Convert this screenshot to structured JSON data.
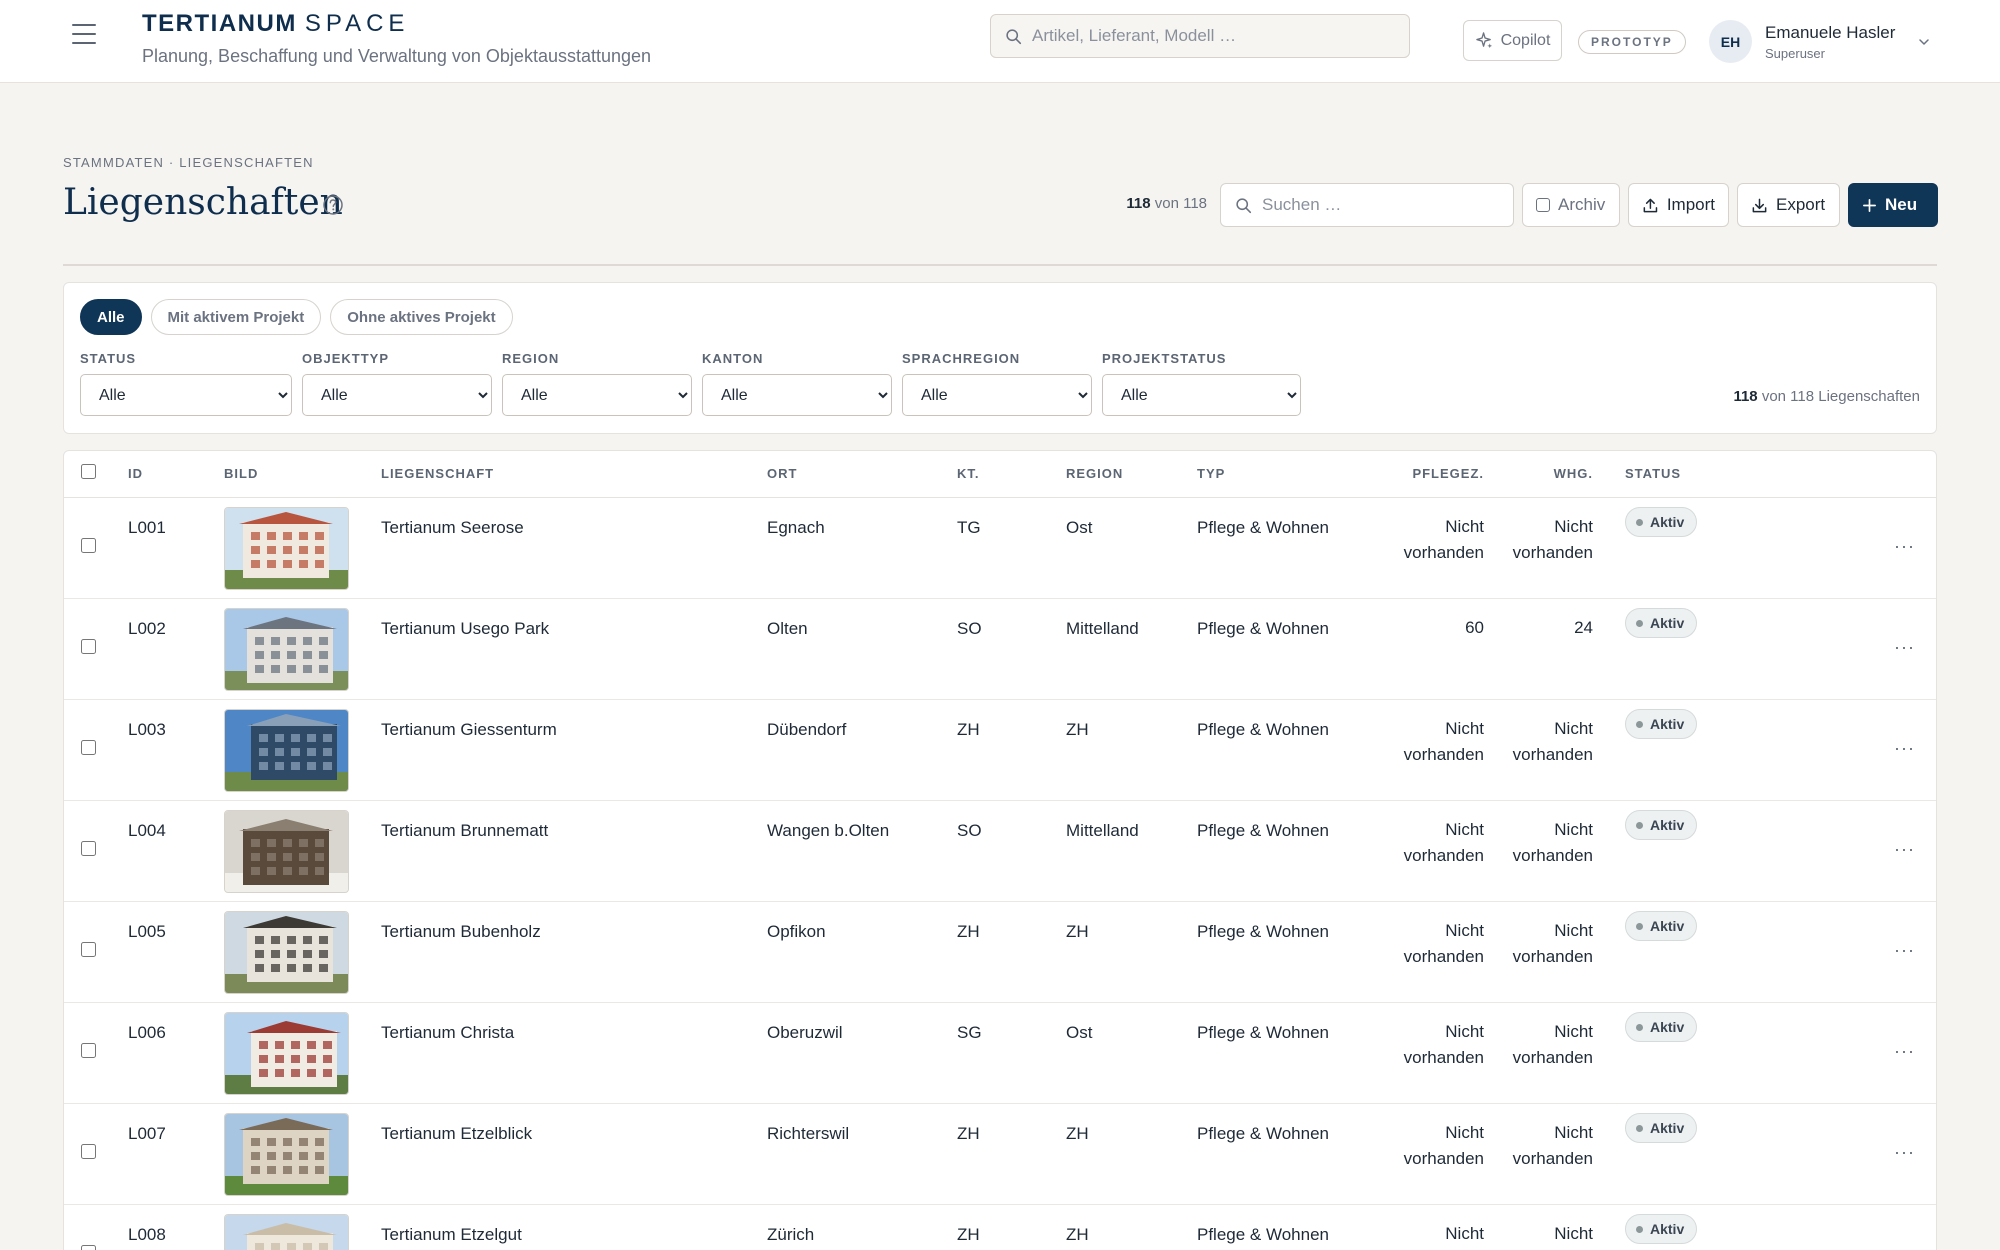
{
  "app": {
    "brand_bold": "TERTIANUM",
    "brand_light": "SPACE",
    "subtitle": "Planung, Beschaffung und Verwaltung von Objektausstattungen"
  },
  "topbar": {
    "search_placeholder": "Artikel, Lieferant, Modell …",
    "copilot_label": "Copilot",
    "prototype_badge": "PROTOTYP",
    "user": {
      "initials": "EH",
      "name": "Emanuele Hasler",
      "role": "Superuser"
    }
  },
  "page": {
    "breadcrumb": "STAMMDATEN · LIEGENSCHAFTEN",
    "title": "Liegenschaften",
    "count_shown": "118",
    "count_total_text": "von 118",
    "search_placeholder": "Suchen …",
    "archiv_label": "Archiv",
    "import_label": "Import",
    "export_label": "Export",
    "new_label": "Neu"
  },
  "filters": {
    "chips": [
      "Alle",
      "Mit aktivem Projekt",
      "Ohne aktives Projekt"
    ],
    "active_chip": "Alle",
    "dropdowns": [
      {
        "label": "STATUS",
        "value": "Alle"
      },
      {
        "label": "OBJEKTTYP",
        "value": "Alle"
      },
      {
        "label": "REGION",
        "value": "Alle"
      },
      {
        "label": "KANTON",
        "value": "Alle"
      },
      {
        "label": "SPRACHREGION",
        "value": "Alle"
      },
      {
        "label": "PROJEKTSTATUS",
        "value": "Alle"
      }
    ],
    "result_count": "118",
    "result_text": "von 118 Liegenschaften"
  },
  "table": {
    "columns": {
      "id": "ID",
      "image": "BILD",
      "name": "LIEGENSCHAFT",
      "city": "ORT",
      "canton": "KT.",
      "region": "REGION",
      "type": "TYP",
      "care": "PFLEGEZ.",
      "apartments": "WHG.",
      "status": "STATUS"
    },
    "rows": [
      {
        "id": "L001",
        "name": "Tertianum Seerose",
        "city": "Egnach",
        "canton": "TG",
        "region": "Ost",
        "type": "Pflege & Wohnen",
        "care": "Nicht vorhanden",
        "apartments": "Nicht vorhanden",
        "status": "Aktiv"
      },
      {
        "id": "L002",
        "name": "Tertianum Usego Park",
        "city": "Olten",
        "canton": "SO",
        "region": "Mittelland",
        "type": "Pflege & Wohnen",
        "care": "60",
        "apartments": "24",
        "status": "Aktiv"
      },
      {
        "id": "L003",
        "name": "Tertianum Giessenturm",
        "city": "Dübendorf",
        "canton": "ZH",
        "region": "ZH",
        "type": "Pflege & Wohnen",
        "care": "Nicht vorhanden",
        "apartments": "Nicht vorhanden",
        "status": "Aktiv"
      },
      {
        "id": "L004",
        "name": "Tertianum Brunnematt",
        "city": "Wangen b.Olten",
        "canton": "SO",
        "region": "Mittelland",
        "type": "Pflege & Wohnen",
        "care": "Nicht vorhanden",
        "apartments": "Nicht vorhanden",
        "status": "Aktiv"
      },
      {
        "id": "L005",
        "name": "Tertianum Bubenholz",
        "city": "Opfikon",
        "canton": "ZH",
        "region": "ZH",
        "type": "Pflege & Wohnen",
        "care": "Nicht vorhanden",
        "apartments": "Nicht vorhanden",
        "status": "Aktiv"
      },
      {
        "id": "L006",
        "name": "Tertianum Christa",
        "city": "Oberuzwil",
        "canton": "SG",
        "region": "Ost",
        "type": "Pflege & Wohnen",
        "care": "Nicht vorhanden",
        "apartments": "Nicht vorhanden",
        "status": "Aktiv"
      },
      {
        "id": "L007",
        "name": "Tertianum Etzelblick",
        "city": "Richterswil",
        "canton": "ZH",
        "region": "ZH",
        "type": "Pflege & Wohnen",
        "care": "Nicht vorhanden",
        "apartments": "Nicht vorhanden",
        "status": "Aktiv"
      },
      {
        "id": "L008",
        "name": "Tertianum Etzelgut",
        "city": "Zürich",
        "canton": "ZH",
        "region": "ZH",
        "type": "Pflege & Wohnen",
        "care": "Nicht vorhanden",
        "apartments": "Nicht vorhanden",
        "status": "Aktiv"
      }
    ],
    "row_menu_label": "···"
  },
  "colors": {
    "brand": "#0f2e4d",
    "primary_button": "#0f3557",
    "background": "#f5f4f1",
    "status_badge_bg": "#eef1f1"
  },
  "icons": [
    "menu-icon",
    "search-icon",
    "sparkle-icon",
    "chevron-down-icon",
    "help-icon",
    "upload-icon",
    "download-icon",
    "plus-icon",
    "more-icon"
  ]
}
